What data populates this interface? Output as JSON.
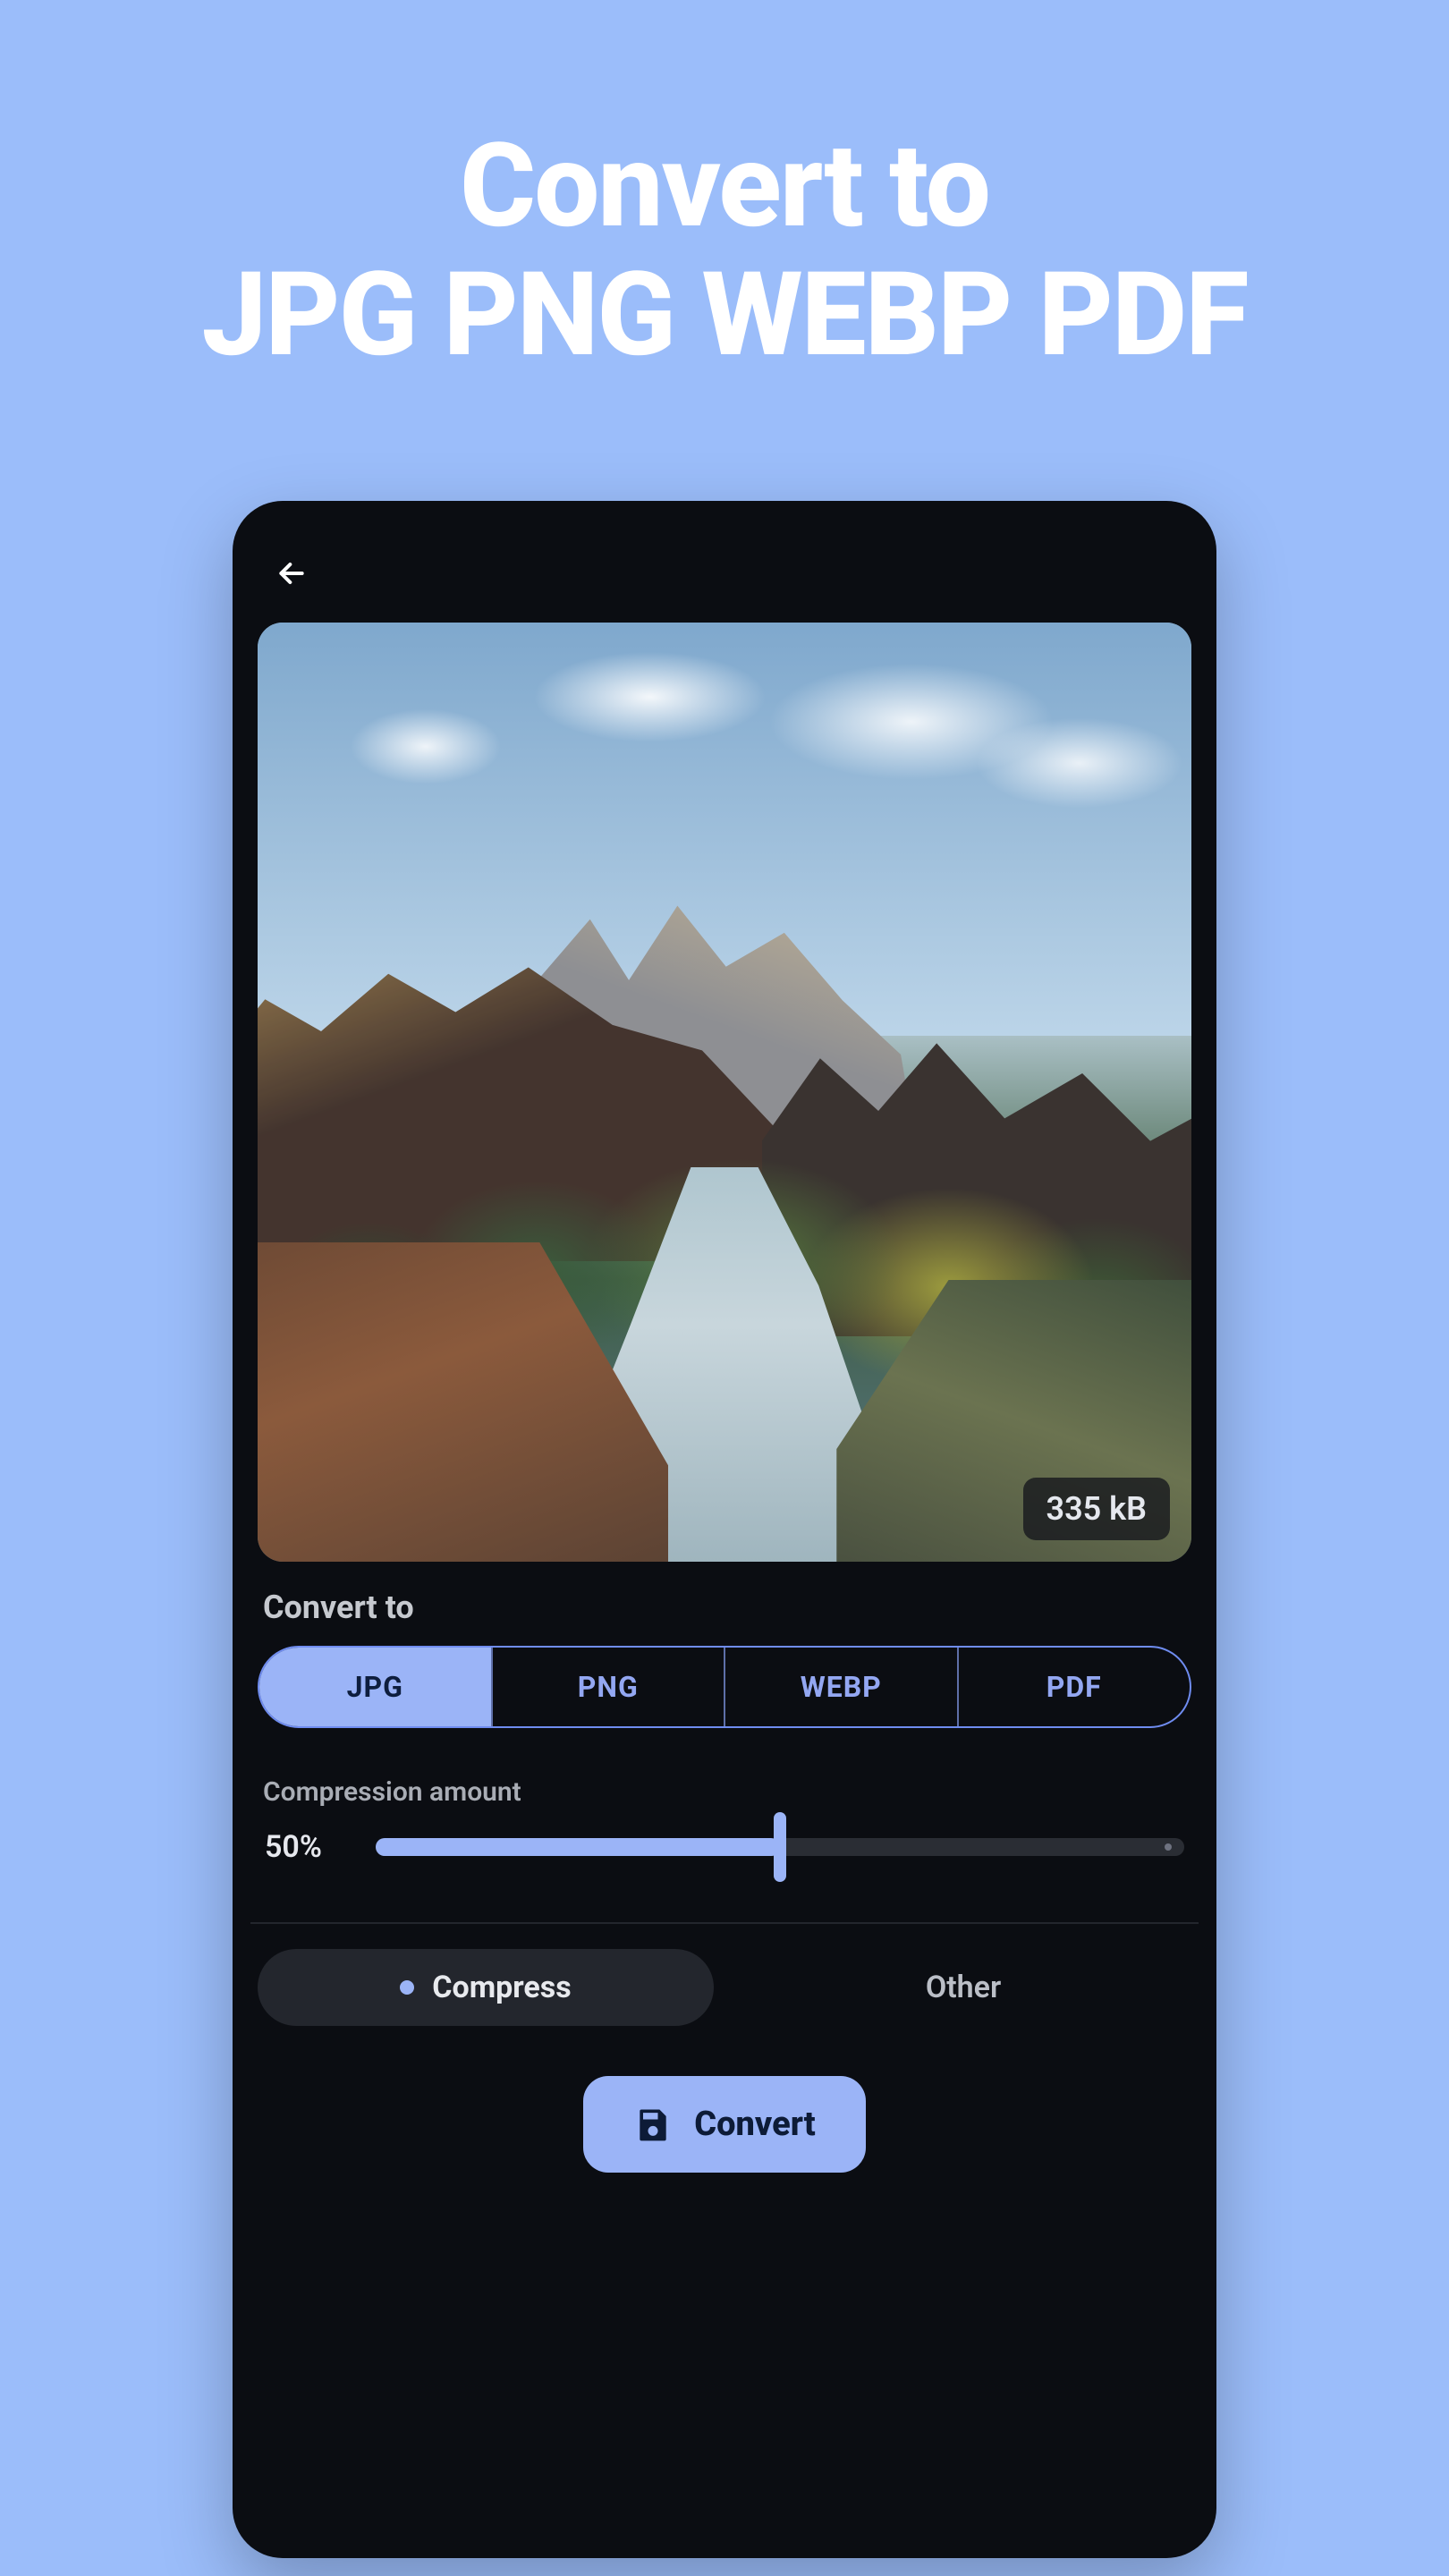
{
  "hero": {
    "line1": "Convert to",
    "line2": "JPG PNG WEBP PDF"
  },
  "preview": {
    "size_label": "335 kB"
  },
  "convert_to": {
    "label": "Convert to",
    "options": [
      "JPG",
      "PNG",
      "WEBP",
      "PDF"
    ],
    "selected_index": 0
  },
  "compression": {
    "label": "Compression amount",
    "value_text": "50%",
    "percent": 50
  },
  "mode": {
    "compress_label": "Compress",
    "other_label": "Other",
    "selected": "compress"
  },
  "action": {
    "convert_label": "Convert"
  }
}
